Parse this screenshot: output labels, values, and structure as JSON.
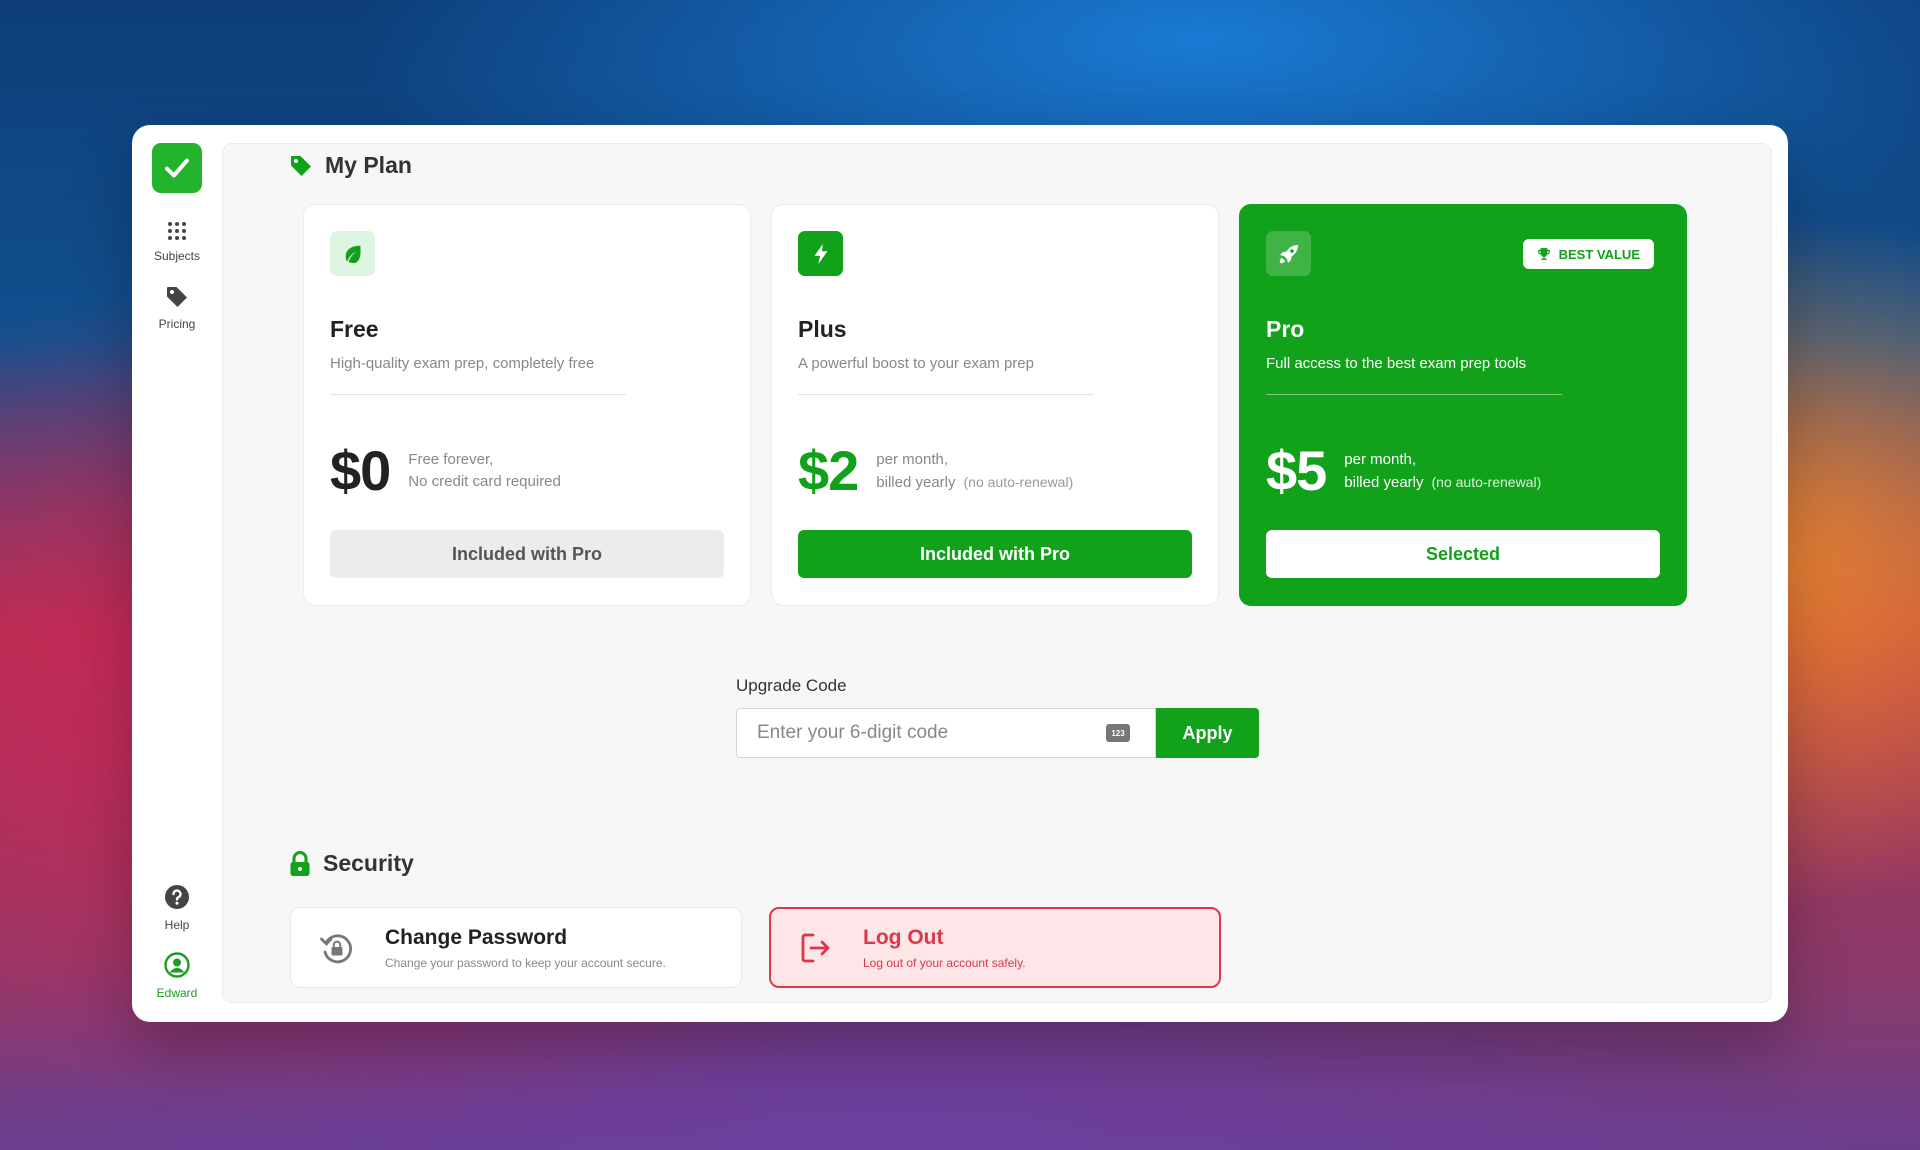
{
  "sidebar": {
    "items": [
      {
        "label": "Subjects",
        "icon": "grid-dots-icon"
      },
      {
        "label": "Pricing",
        "icon": "tag-icon"
      }
    ],
    "help_label": "Help",
    "user_label": "Edward"
  },
  "plan_section": {
    "title": "My Plan",
    "plans": [
      {
        "name": "Free",
        "description": "High-quality exam prep, completely free",
        "price": "$0",
        "note_line1": "Free forever,",
        "note_line2": "No credit card required",
        "button": "Included with Pro",
        "icon": "leaf-icon"
      },
      {
        "name": "Plus",
        "description": "A powerful boost to your exam prep",
        "price": "$2",
        "note_line1": "per month,",
        "note_line2": "billed yearly",
        "note_extra": "(no auto-renewal)",
        "button": "Included with Pro",
        "icon": "bolt-icon"
      },
      {
        "name": "Pro",
        "description": "Full access to the best exam prep tools",
        "price": "$5",
        "note_line1": "per month,",
        "note_line2": "billed yearly",
        "note_extra": "(no auto-renewal)",
        "button": "Selected",
        "badge": "BEST VALUE",
        "icon": "rocket-icon"
      }
    ]
  },
  "upgrade": {
    "label": "Upgrade Code",
    "placeholder": "Enter your 6-digit code",
    "keyboard_hint": "123",
    "apply_label": "Apply"
  },
  "security": {
    "title": "Security",
    "change_password": {
      "title": "Change Password",
      "subtitle": "Change your password to keep your account secure."
    },
    "logout": {
      "title": "Log Out",
      "subtitle": "Log out of your account safely."
    }
  },
  "colors": {
    "accent": "#11a11a",
    "danger": "#e0364a"
  }
}
